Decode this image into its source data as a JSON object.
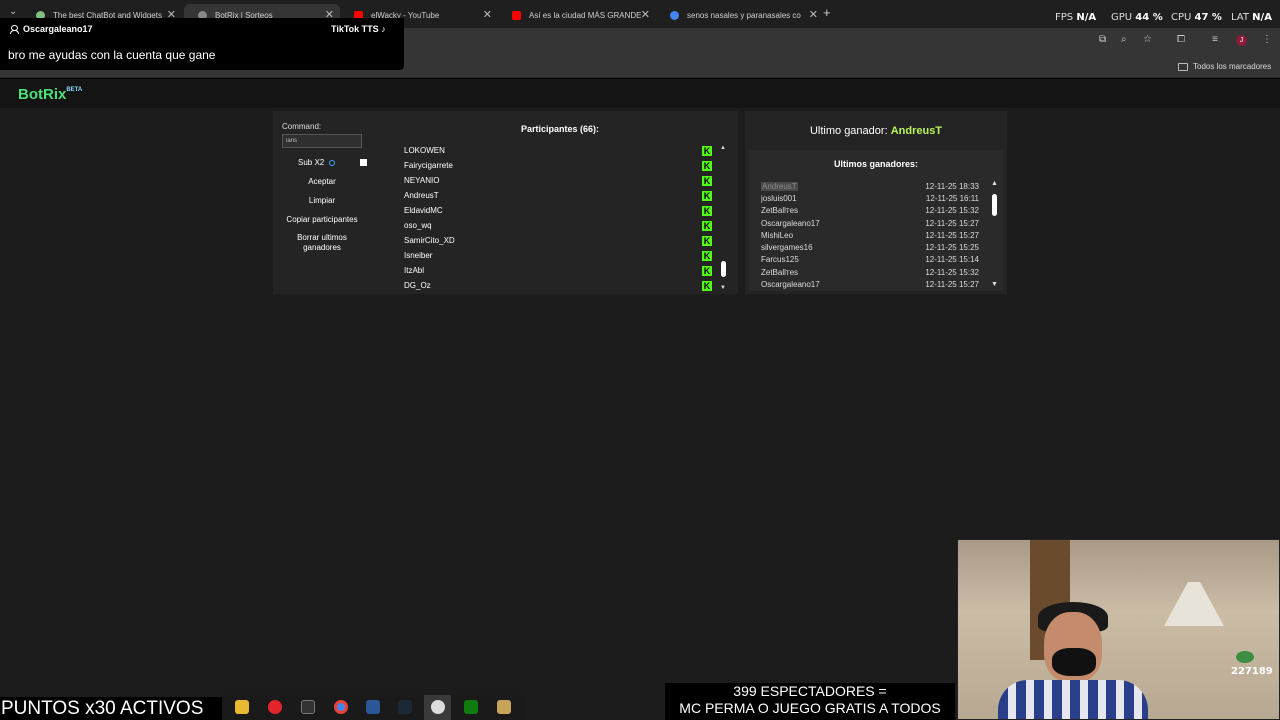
{
  "browser": {
    "tabs": [
      {
        "label": "The best ChatBot and Widgets",
        "color": "#7fbf7f"
      },
      {
        "label": "BotRix | Sorteos",
        "color": "#888888"
      },
      {
        "label": "elWacky - YouTube",
        "color": "#ff0000"
      },
      {
        "label": "Así es la ciudad MÁS GRANDE",
        "color": "#ff0000"
      },
      {
        "label": "senos nasales y paranasales co",
        "color": "#4285f4"
      }
    ],
    "bookmarks_all": "Todos los marcadores",
    "profile_initial": "J"
  },
  "perf": {
    "fps_label": "FPS",
    "fps_value": "N/A",
    "gpu_label": "GPU",
    "gpu_value": "44 %",
    "cpu_label": "CPU",
    "cpu_value": "47 %",
    "lat_label": "LAT",
    "lat_value": "N/A"
  },
  "tts": {
    "user": "Oscargaleano17",
    "title": "TikTok TTS",
    "message": "bro me ayudas con la cuenta que gane"
  },
  "app": {
    "logo": "BotRix",
    "logo_badge": "BETA"
  },
  "controls": {
    "command_label": "Command:",
    "command_value": "laris",
    "sub_label": "Sub X2",
    "accept": "Aceptar",
    "clear": "Limpiar",
    "copy": "Copiar participantes",
    "delete_winners": "Borrar ultimos ganadores"
  },
  "participants": {
    "title_prefix": "Participantes",
    "count": "(66)",
    "title_suffix": ":",
    "items": [
      "LOKOWEN",
      "Fairycigarrete",
      "NEYANIO",
      "AndreusT",
      "EldavidMC",
      "oso_wq",
      "SamirCito_XD",
      "Isneiber",
      "ItzAbl",
      "DG_Oz"
    ]
  },
  "winners": {
    "last_label": "Ultimo ganador:",
    "last_name": "AndreusT",
    "list_title": "Ultimos ganadores:",
    "items": [
      {
        "name": "AndreusT",
        "date": "12-11-25 18:33"
      },
      {
        "name": "josluis001",
        "date": "12-11-25 16:11"
      },
      {
        "name": "ZetBallтes",
        "date": "12-11-25 15:32"
      },
      {
        "name": "Oscargaleano17",
        "date": "12-11-25 15:27"
      },
      {
        "name": "MishiLeo",
        "date": "12-11-25 15:27"
      },
      {
        "name": "silvergames16",
        "date": "12-11-25 15:25"
      },
      {
        "name": "Farcus125",
        "date": "12-11-25 15:14"
      },
      {
        "name": "ZetBallтes",
        "date": "12-11-25 15:32"
      },
      {
        "name": "Oscargaleano17",
        "date": "12-11-25 15:27"
      }
    ]
  },
  "stream": {
    "points_banner": "PUNTOS x30 ACTIVOS",
    "viewers_line1": "399 ESPECTADORES =",
    "viewers_line2": "MC PERMA O JUEGO GRATIS A TODOS",
    "cam_count": "227189"
  }
}
